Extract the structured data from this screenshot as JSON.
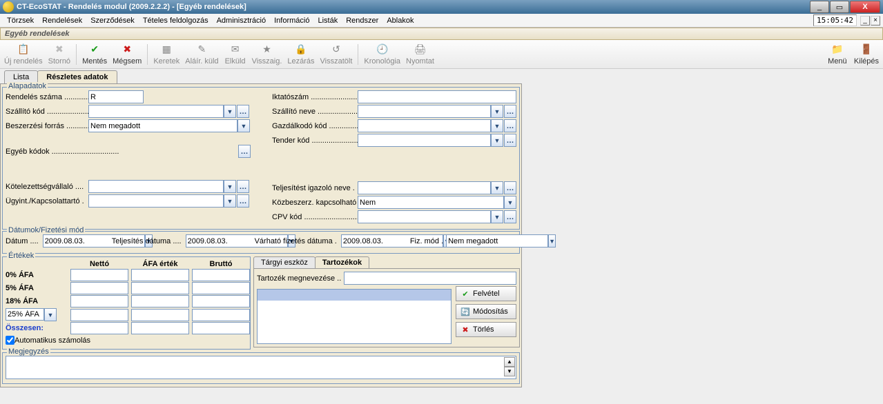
{
  "window": {
    "title": "CT-EcoSTAT - Rendelés modul (2009.2.2.2) - [Egyéb rendelések]"
  },
  "menubar": {
    "items": [
      "Törzsek",
      "Rendelések",
      "Szerződések",
      "Tételes feldolgozás",
      "Adminisztráció",
      "Információ",
      "Listák",
      "Rendszer",
      "Ablakok"
    ],
    "clock": "15:05:42"
  },
  "module_title": "Egyéb rendelések",
  "toolbar": {
    "new": "Új rendelés",
    "storno": "Stornó",
    "save": "Mentés",
    "cancel": "Mégsem",
    "keretek": "Keretek",
    "alairkuldott": "Aláír. küld",
    "elkuld": "Elküld",
    "visszaig": "Visszaig.",
    "lezaras": "Lezárás",
    "visszatolt": "Visszatölt",
    "kronologia": "Kronológia",
    "nyomtat": "Nyomtat",
    "menu": "Menü",
    "kilepes": "Kilépés"
  },
  "tabs": {
    "lista": "Lista",
    "reszletes": "Részletes adatok"
  },
  "sections": {
    "alap": "Alapadatok",
    "datum": "Dátumok/Fizetési mód",
    "ertekek": "Értékek",
    "megjegyzes": "Megjegyzés"
  },
  "labels": {
    "rendeles_szama": "Rendelés száma",
    "szallito_kod": "Szállító kód",
    "beszerzesi_forras": "Beszerzési forrás",
    "egyeb_kodok": "Egyéb kódok",
    "kotelezettseg": "Kötelezettségvállaló",
    "ugyint": "Ügyint./Kapcsolattartó .",
    "iktatoszam": "Iktatószám",
    "szallito_neve": "Szállító neve",
    "gazdalkodo": "Gazdálkodó kód",
    "tender_kod": "Tender kód",
    "teljesitest_igazolo": "Teljesítést igazoló neve .",
    "kozbeszerz": "Közbeszerz. kapcsolható",
    "cpv_kod": "CPV kód",
    "datum": "Dátum",
    "teljesites_datuma": "Teljesítés dátuma",
    "varhato_fizetes": "Várható fizetés dátuma .",
    "fiz_mod": "Fiz. mód .",
    "netto": "Nettó",
    "afa_ertek": "ÁFA érték",
    "brutto": "Bruttó",
    "osszesen": "Összesen:",
    "auto": " Automatikus számolás",
    "targyi": "Tárgyi eszköz",
    "tartozekok": "Tartozékok",
    "tartozek_megnev": "Tartozék megnevezése",
    "felvetel": "Felvétel",
    "modositas": "Módosítás",
    "torles": "Törlés"
  },
  "values": {
    "rendeles_szama": "R",
    "beszerzesi_forras": "Nem megadott",
    "kozbeszerz": "Nem",
    "datum": "2009.08.03.",
    "teljesites_datuma": "2009.08.03.",
    "varhato_fizetes": "2009.08.03.",
    "fiz_mod": "Nem megadott",
    "afa_rows": [
      "0% ÁFA",
      "5% ÁFA",
      "18% ÁFA"
    ],
    "afa_select": "25% ÁFA"
  }
}
